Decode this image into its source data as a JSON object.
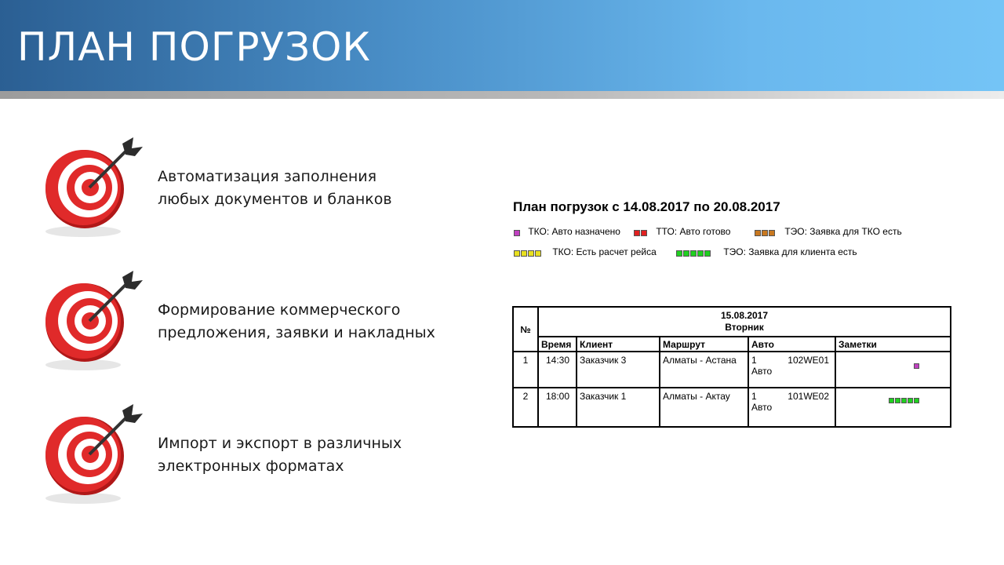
{
  "header": {
    "title": "ПЛАН ПОГРУЗОК"
  },
  "features": [
    {
      "text": "Автоматизация заполнения\nлюбых документов и бланков"
    },
    {
      "text": "Формирование коммерческого\nпредложения, заявки и накладных"
    },
    {
      "text": "Импорт и экспорт в различных\nэлектронных форматах"
    }
  ],
  "plan": {
    "title": "План погрузок с 14.08.2017 по 20.08.2017",
    "legend": [
      {
        "label": "ТКО: Авто назначено",
        "color": "#c040c0",
        "count": 1
      },
      {
        "label": "ТТО: Авто готово",
        "color": "#e02020",
        "count": 2
      },
      {
        "label": "ТЭО: Заявка для ТКО есть",
        "color": "#c87820",
        "count": 3
      },
      {
        "label": "ТКО: Есть расчет рейса",
        "color": "#e8e020",
        "count": 4
      },
      {
        "label": "ТЭО: Заявка для клиента есть",
        "color": "#20d020",
        "count": 5
      }
    ],
    "table": {
      "num_header": "№",
      "date": "15.08.2017",
      "weekday": "Вторник",
      "columns": [
        "Время",
        "Клиент",
        "Маршрут",
        "Авто",
        "Заметки"
      ],
      "rows": [
        {
          "num": "1",
          "time": "14:30",
          "client": "Заказчик 3",
          "route": "Алматы - Астана",
          "auto_num": "1",
          "auto_label": "Авто",
          "auto_plate": "102WE01",
          "note_color": "#c040c0",
          "note_count": 1
        },
        {
          "num": "2",
          "time": "18:00",
          "client": "Заказчик 1",
          "route": "Алматы - Актау",
          "auto_num": "1",
          "auto_label": "Авто",
          "auto_plate": "101WE02",
          "note_color": "#20d020",
          "note_count": 5
        }
      ]
    }
  }
}
